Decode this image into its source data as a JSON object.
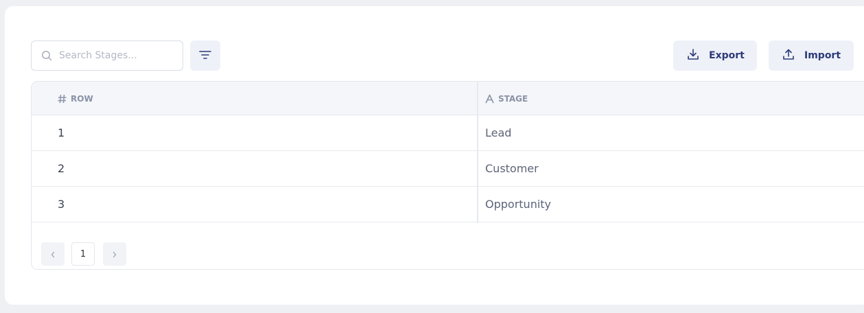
{
  "toolbar": {
    "search": {
      "placeholder": "Search Stages...",
      "value": "",
      "icon": "search-icon"
    },
    "filter": {
      "icon": "filter-icon"
    },
    "export": {
      "label": "Export",
      "icon": "download-icon"
    },
    "import": {
      "label": "Import",
      "icon": "upload-icon"
    },
    "accent_color": "#2c3a78"
  },
  "table": {
    "columns": [
      {
        "label": "ROW",
        "icon": "hash-icon"
      },
      {
        "label": "STAGE",
        "icon": "text-type-icon"
      }
    ],
    "rows": [
      {
        "row": "1",
        "stage": "Lead"
      },
      {
        "row": "2",
        "stage": "Customer"
      },
      {
        "row": "3",
        "stage": "Opportunity"
      }
    ]
  },
  "pagination": {
    "current_page": "1",
    "prev_icon": "chevron-left-icon",
    "next_icon": "chevron-right-icon"
  }
}
